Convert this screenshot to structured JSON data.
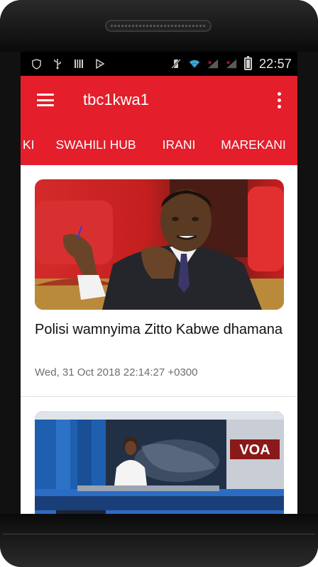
{
  "status_bar": {
    "time": "22:57",
    "left_icons": [
      "shield-icon",
      "usb-icon",
      "barcode-icon",
      "play-store-icon"
    ],
    "right_icons": [
      "vibrate-off-icon",
      "wifi-icon",
      "signal-icon",
      "signal-icon",
      "battery-icon"
    ]
  },
  "app_bar": {
    "title": "tbc1kwa1",
    "menu_icon": "hamburger-menu-icon",
    "overflow_icon": "more-vertical-icon"
  },
  "tabs": {
    "items": [
      {
        "label": "KI"
      },
      {
        "label": "SWAHILI HUB"
      },
      {
        "label": "IRANI"
      },
      {
        "label": "MAREKANI"
      }
    ],
    "selected": "MAREKANI"
  },
  "articles": [
    {
      "headline": "Polisi wamnyima Zitto Kabwe dhamana",
      "timestamp": "Wed, 31 Oct 2018 22:14:27 +0300"
    },
    {
      "headline": "",
      "timestamp": ""
    }
  ],
  "colors": {
    "brand_red": "#e41e2b",
    "status_bar": "#000000",
    "text_primary": "#111111",
    "text_secondary": "#6e6e6e"
  }
}
